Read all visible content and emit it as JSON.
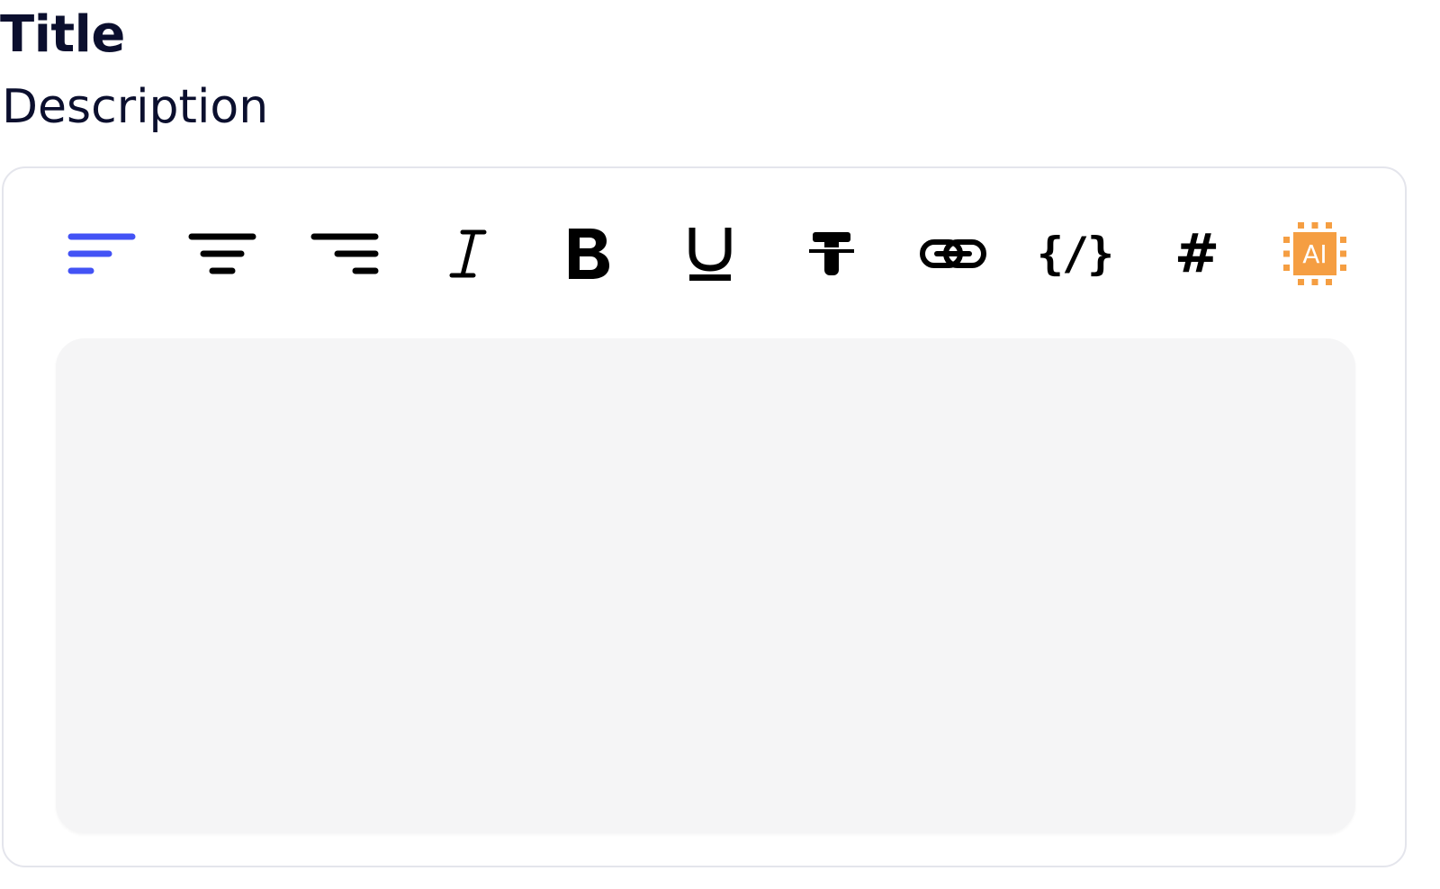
{
  "header": {
    "title": "Title",
    "description": "Description"
  },
  "toolbar": {
    "items": [
      {
        "name": "align-left",
        "icon": "align-left-icon",
        "active": true
      },
      {
        "name": "align-center",
        "icon": "align-center-icon",
        "active": false
      },
      {
        "name": "align-right",
        "icon": "align-right-icon",
        "active": false
      },
      {
        "name": "italic",
        "icon": "italic-icon",
        "active": false
      },
      {
        "name": "bold",
        "icon": "bold-icon",
        "active": false
      },
      {
        "name": "underline",
        "icon": "underline-icon",
        "active": false
      },
      {
        "name": "strikethrough",
        "icon": "strikethrough-icon",
        "active": false
      },
      {
        "name": "link",
        "icon": "link-icon",
        "active": false
      },
      {
        "name": "code",
        "icon": "code-icon",
        "active": false
      },
      {
        "name": "heading",
        "icon": "hash-icon",
        "active": false
      },
      {
        "name": "ai",
        "icon": "ai-chip-icon",
        "active": false
      }
    ],
    "code_icon_text": "{/}",
    "heading_icon_text": "#",
    "ai_icon_text": "AI"
  },
  "editor": {
    "value": ""
  },
  "colors": {
    "text": "#0b0f2e",
    "active_tool": "#4353f5",
    "icon": "#000000",
    "ai": "#f59e42",
    "card_border": "#e4e5ec",
    "editor_bg": "#f5f5f6"
  }
}
